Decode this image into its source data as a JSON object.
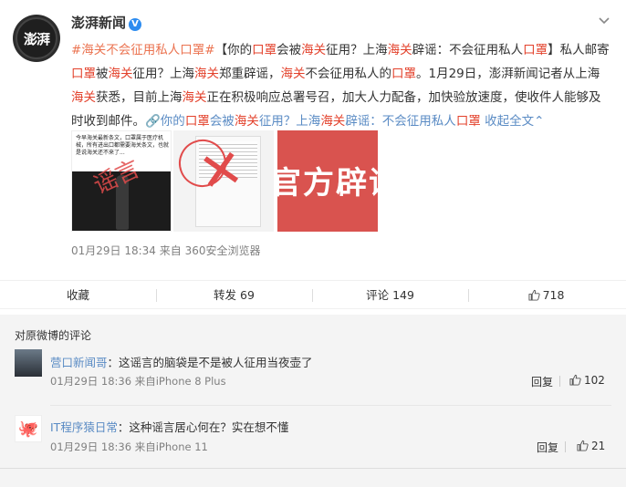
{
  "post": {
    "username": "澎湃新闻",
    "avatar_text": "澎湃",
    "verified_badge": "V",
    "content_parts": [
      {
        "t": "#海关不会征用私人口罩#",
        "c": "link"
      },
      {
        "t": "【你的",
        "c": "plain"
      },
      {
        "t": "口罩",
        "c": "red"
      },
      {
        "t": "会被",
        "c": "plain"
      },
      {
        "t": "海关",
        "c": "red"
      },
      {
        "t": "征用？上海",
        "c": "plain"
      },
      {
        "t": "海关",
        "c": "red"
      },
      {
        "t": "辟谣：不会征用私人",
        "c": "plain"
      },
      {
        "t": "口罩",
        "c": "red"
      },
      {
        "t": "】私人邮寄",
        "c": "plain"
      },
      {
        "t": "口罩",
        "c": "red"
      },
      {
        "t": "被",
        "c": "plain"
      },
      {
        "t": "海关",
        "c": "red"
      },
      {
        "t": "征用？上海",
        "c": "plain"
      },
      {
        "t": "海关",
        "c": "red"
      },
      {
        "t": "郑重辟谣，",
        "c": "plain"
      },
      {
        "t": "海关",
        "c": "red"
      },
      {
        "t": "不会征用私人的",
        "c": "plain"
      },
      {
        "t": "口罩",
        "c": "red"
      },
      {
        "t": "。1月29日，澎湃新闻记者从上海",
        "c": "plain"
      },
      {
        "t": "海关",
        "c": "red"
      },
      {
        "t": "获悉，目前上海",
        "c": "plain"
      },
      {
        "t": "海关",
        "c": "red"
      },
      {
        "t": "正在积极响应总署号召，加大人力配备，加快验放速度，使收件人能够及时收到邮件。",
        "c": "plain"
      },
      {
        "t": "🔗你的",
        "c": "blue"
      },
      {
        "t": "口罩",
        "c": "red"
      },
      {
        "t": "会被",
        "c": "blue"
      },
      {
        "t": "海关",
        "c": "red"
      },
      {
        "t": "征用？上海",
        "c": "blue"
      },
      {
        "t": "海关",
        "c": "red"
      },
      {
        "t": "辟谣：不会征用私人",
        "c": "blue"
      },
      {
        "t": "口罩",
        "c": "red"
      },
      {
        "t": " 收起全文",
        "c": "blue"
      },
      {
        "t": "⌃",
        "c": "blue"
      }
    ],
    "images": {
      "img1_caption": "今早海关最新条文，口罩属于医疗机械，所有进出口都需要海关条文，也就是说海关还不来了...",
      "img1_stamp": "谣言",
      "img3_text": "官方辟谣"
    },
    "timestamp": "01月29日 18:34",
    "source": "来自 360安全浏览器"
  },
  "actions": {
    "favorite": "收藏",
    "repost_label": "转发",
    "repost_count": "69",
    "comment_label": "评论",
    "comment_count": "149",
    "like_count": "718"
  },
  "comments_section": {
    "title": "对原微博的评论",
    "items": [
      {
        "name": "营口新闻哥",
        "text": "：这谣言的脑袋是不是被人征用当夜壶了",
        "time": "01月29日 18:36",
        "source": "来自iPhone 8 Plus",
        "reply": "回复",
        "likes": "102"
      },
      {
        "name": "IT程序猿日常",
        "text": "：这种谣言居心何在？实在想不懂",
        "time": "01月29日 18:36",
        "source": "来自iPhone 11",
        "reply": "回复",
        "likes": "21"
      }
    ]
  },
  "colors": {
    "link": "#eb7350",
    "blue": "#5a8bc4",
    "red": "#e3412b",
    "verified": "#2d8cf0"
  },
  "icons": [
    "chevron-down-icon",
    "thumb-up-icon",
    "verified-icon",
    "link-icon"
  ]
}
